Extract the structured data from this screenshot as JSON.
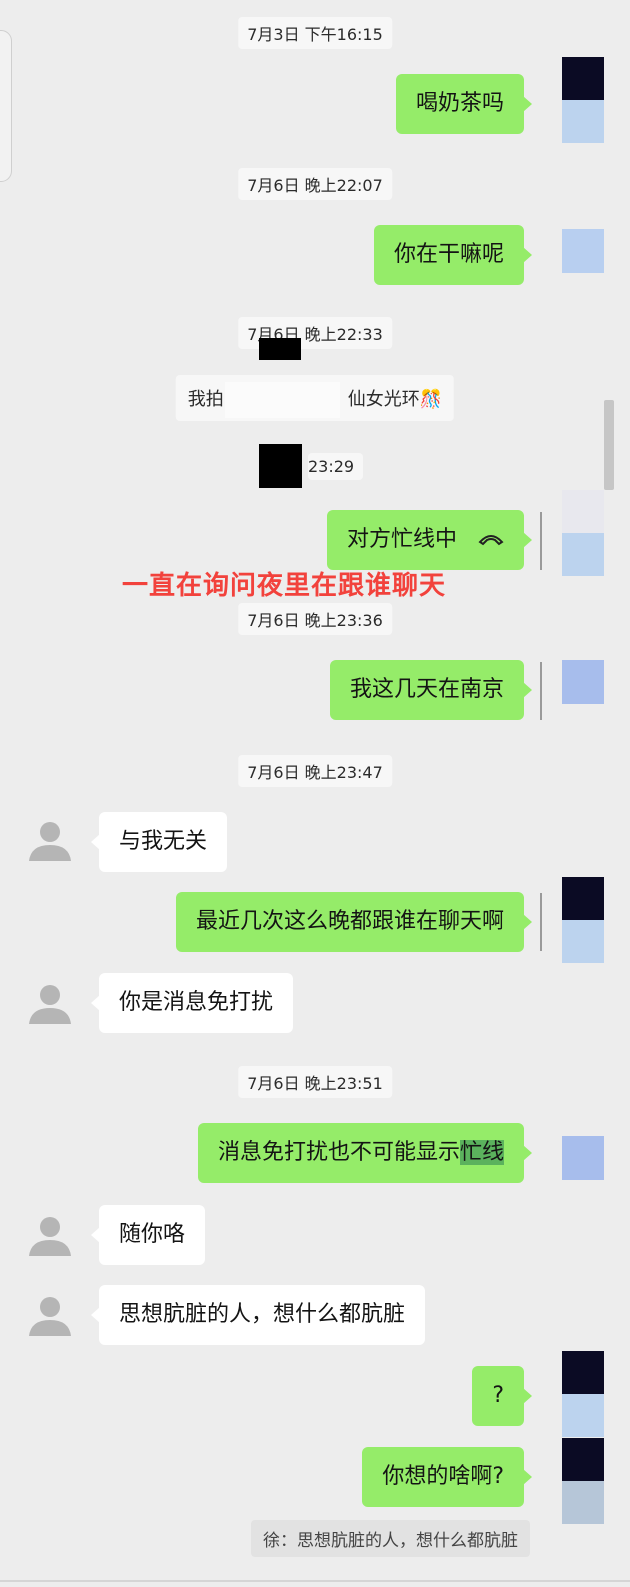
{
  "messages": {
    "ts1": "7月3日 下午16:15",
    "m1": "喝奶茶吗",
    "ts2": "7月6日 晚上22:07",
    "m2": "你在干嘛呢",
    "ts3": "7月6日 晚上22:33",
    "sys_pat_left": "我拍了",
    "sys_pat_right": "仙女光环",
    "sys_pat_emoji": "🎊",
    "ts4": "23:29",
    "m3_call": "对方忙线中",
    "annotation": "一直在询问夜里在跟谁聊天",
    "ts5": "7月6日 晚上23:36",
    "m4": "我这几天在南京",
    "ts6": "7月6日 晚上23:47",
    "r1": "与我无关",
    "m5": "最近几次这么晚都跟谁在聊天啊",
    "r2": "你是消息免打扰",
    "ts7": "7月6日 晚上23:51",
    "m6_prefix": "消息免打扰也不可能显示",
    "m6_highlight": "忙线",
    "r3": "随你咯",
    "r4": "思想肮脏的人，想什么都肮脏",
    "m7": "?",
    "m8": "你想的啥啊?",
    "quote": "徐：思想肮脏的人，想什么都肮脏"
  },
  "colors": {
    "background": "#ededed",
    "my_bubble": "#95ec69",
    "their_bubble": "#ffffff",
    "annotation": "#f2423c"
  }
}
